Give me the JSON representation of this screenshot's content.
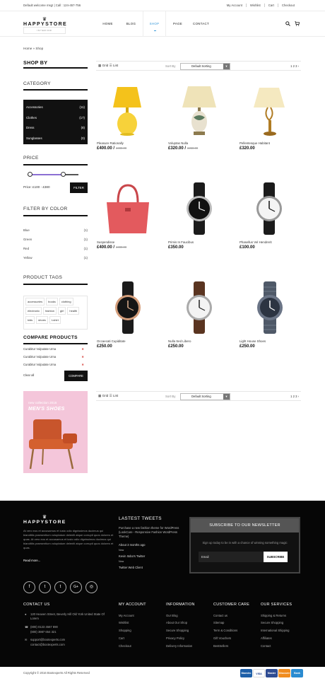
{
  "topbar": {
    "welcome": "Default welcome msg! | Call : 124-457-756",
    "links": [
      "My Account",
      "Wishlist",
      "Cart",
      "Checkout"
    ]
  },
  "header": {
    "logo": "HAPPYSTORE",
    "logo_tagline": "INTERIOR",
    "nav": [
      "HOME",
      "BLOG",
      "SHOP",
      "PAGE",
      "CONTACT"
    ],
    "active_nav": "SHOP"
  },
  "breadcrumb": {
    "home": "Home",
    "sep": "»",
    "current": "Shop"
  },
  "sidebar": {
    "shop_by": "SHOP BY",
    "category_title": "CATEGORY",
    "categories": [
      {
        "name": "Accessories",
        "count": "(11)"
      },
      {
        "name": "Clothes",
        "count": "(17)"
      },
      {
        "name": "Dress",
        "count": "(8)"
      },
      {
        "name": "Sunglasses",
        "count": "(0)"
      }
    ],
    "price_title": "PRICE",
    "price_range": "Price: £100 - £380",
    "filter_label": "FILTER",
    "color_title": "FILTER BY COLOR",
    "colors": [
      {
        "name": "Blue",
        "count": "(1)"
      },
      {
        "name": "Green",
        "count": "(1)"
      },
      {
        "name": "Red",
        "count": "(1)"
      },
      {
        "name": "Yellow",
        "count": "(1)"
      }
    ],
    "tags_title": "PRODUCT TAGS",
    "tags": [
      [
        "accessories",
        "books",
        "clothing"
      ],
      [
        "electronic",
        "fashion",
        "girl",
        "health"
      ],
      [
        "kids",
        "shoes",
        "t-shirt"
      ]
    ],
    "compare_title": "COMPARE PRODUCTS",
    "compare_items": [
      "Curabitur Vulputate Urna",
      "Curabitur Vulputate Urna",
      "Curabitur Vulputate Urna"
    ],
    "clear_all": "Clear all",
    "compare_btn": "COMPARE",
    "banner_line1": "new collection 2016",
    "banner_line2": "MEN'S SHOES"
  },
  "toolbar": {
    "grid": "Grid",
    "list": "List",
    "sort_label": "Sort By",
    "sort_value": "Default Sorting",
    "pagination": "1 2 3 ›"
  },
  "products": [
    {
      "name": "Pleasure Rationally",
      "price": "£400.00 /",
      "old": "£380.00",
      "image": "yellow-lamp"
    },
    {
      "name": "Voluptas Nulla",
      "price": "£320.00 /",
      "old": "£350.00",
      "image": "table-lamp"
    },
    {
      "name": "Pellentesque Habitant",
      "price": "£320.00",
      "old": "",
      "image": "brass-lamp"
    },
    {
      "name": "Suspendisse",
      "price": "£400.00 /",
      "old": "£380.00",
      "image": "red-handbag"
    },
    {
      "name": "Primis In Faucibus",
      "price": "£350.00",
      "old": "",
      "image": "black-watch"
    },
    {
      "name": "Phasellus Vel Hendrerit",
      "price": "£100.00",
      "old": "",
      "image": "white-watch"
    },
    {
      "name": "Occaecati Cupiditate",
      "price": "£250.00",
      "old": "",
      "image": "rose-watch"
    },
    {
      "name": "Nulla Sed Libero",
      "price": "£250.00",
      "old": "",
      "image": "brown-watch"
    },
    {
      "name": "Light House Shoes",
      "price": "£250.00",
      "old": "",
      "image": "steel-watch"
    }
  ],
  "footer": {
    "logo": "HAPPYSTORE",
    "about": "At vero eos et accusamus et iusto odio dignissimos ducimus qui blanditiis praesentium voluptatum deleniti atque corrupti quos dolores et quas. At vero eos et accusamus et iusto odio dignissimos ducimus qui blanditiis praesentium voluptatum deleniti atque corrupti quos dolores et quas.",
    "read_more": "Read more...",
    "social": [
      "f",
      "t",
      "t",
      "G+",
      "◎"
    ],
    "tweets_title": "LASTEST TWEETS",
    "tweet1": "Purchase a new fashion theme for WordPress (LookCare - Responsive Fashion WordPress Theme)",
    "tweet1_time": "About 3 months ago",
    "tweet1_via": "Now",
    "tweet2": "Kevin Itobo's Twitter",
    "tweet2_via": "Now",
    "tweet3": "Twitter Web Client",
    "newsletter_title": "SUBSCRIBE TO OUR NEWSLETTER",
    "newsletter_text": "Sign up today to be in with a chance of winning something magic",
    "email_placeholder": "Email",
    "subscribe": "SUBSCRIBE",
    "contact_title": "CONTACT US",
    "address": "120 Heaven Street, Beverly Hill Old York United State Of Lorem",
    "phone": "(800) 0123 4567 890",
    "phone2": "(800) 3987 654 321",
    "email1": "support@bootexperts.com",
    "email2": "contact@bootexperts.com",
    "account_title": "MY ACCOUNT",
    "account_items": [
      "My Account",
      "Wishlist",
      "Shopping",
      "Cart",
      "Checkout"
    ],
    "info_title": "INFORMATION",
    "info_items": [
      "Our Blog",
      "About Our Shop",
      "Secure Shopping",
      "Privacy Policy",
      "Delivery Information"
    ],
    "care_title": "CUSTOMER CARE",
    "care_items": [
      "Contact us",
      "Sitemap",
      "Term & Conditions",
      "Gift Vouchers",
      "BestSellers"
    ],
    "services_title": "OUR SERVICES",
    "services_items": [
      "Shipping & Returns",
      "Secure Shopping",
      "International Shipping",
      "Affiliates",
      "Contact"
    ],
    "copyright": "Copyright © 2016 Bootexperts All Rights Reserved",
    "payments": [
      "Maestro",
      "VISA",
      "Master",
      "Discover",
      "Bank"
    ]
  },
  "colors": {
    "accent": "#3a9ad9",
    "footer_bg": "#060606",
    "banner_bg": "#f4c6da"
  }
}
